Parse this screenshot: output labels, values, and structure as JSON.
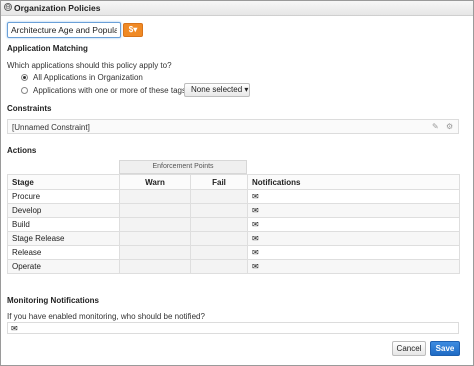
{
  "panel": {
    "title": "Organization Policies",
    "collapse_glyph": "⊖"
  },
  "policy": {
    "name_value": "Architecture Age and Popularity",
    "currency_label": "$▾"
  },
  "application_matching": {
    "heading": "Application Matching",
    "question": "Which applications should this policy apply to?",
    "options": [
      {
        "label": "All Applications in Organization",
        "selected": true
      },
      {
        "label": "Applications with one or more of these tags",
        "selected": false
      }
    ],
    "tags_dropdown": "None selected ▾"
  },
  "constraints": {
    "heading": "Constraints",
    "items": [
      {
        "label": "[Unnamed Constraint]"
      }
    ],
    "edit_glyph": "✎",
    "settings_glyph": "⚙"
  },
  "actions": {
    "heading": "Actions",
    "enforcement_points_label": "Enforcement Points",
    "columns": {
      "stage": "Stage",
      "warn": "Warn",
      "fail": "Fail",
      "notifications": "Notifications"
    },
    "envelope_glyph": "✉",
    "rows": [
      {
        "stage": "Procure"
      },
      {
        "stage": "Develop"
      },
      {
        "stage": "Build"
      },
      {
        "stage": "Stage Release"
      },
      {
        "stage": "Release"
      },
      {
        "stage": "Operate"
      }
    ]
  },
  "monitoring": {
    "heading": "Monitoring Notifications",
    "question": "If you have enabled monitoring, who should be notified?"
  },
  "footer": {
    "cancel_label": "Cancel",
    "save_label": "Save"
  },
  "colors": {
    "accent_blue": "#1f6bc4",
    "currency_orange": "#f08a25"
  }
}
